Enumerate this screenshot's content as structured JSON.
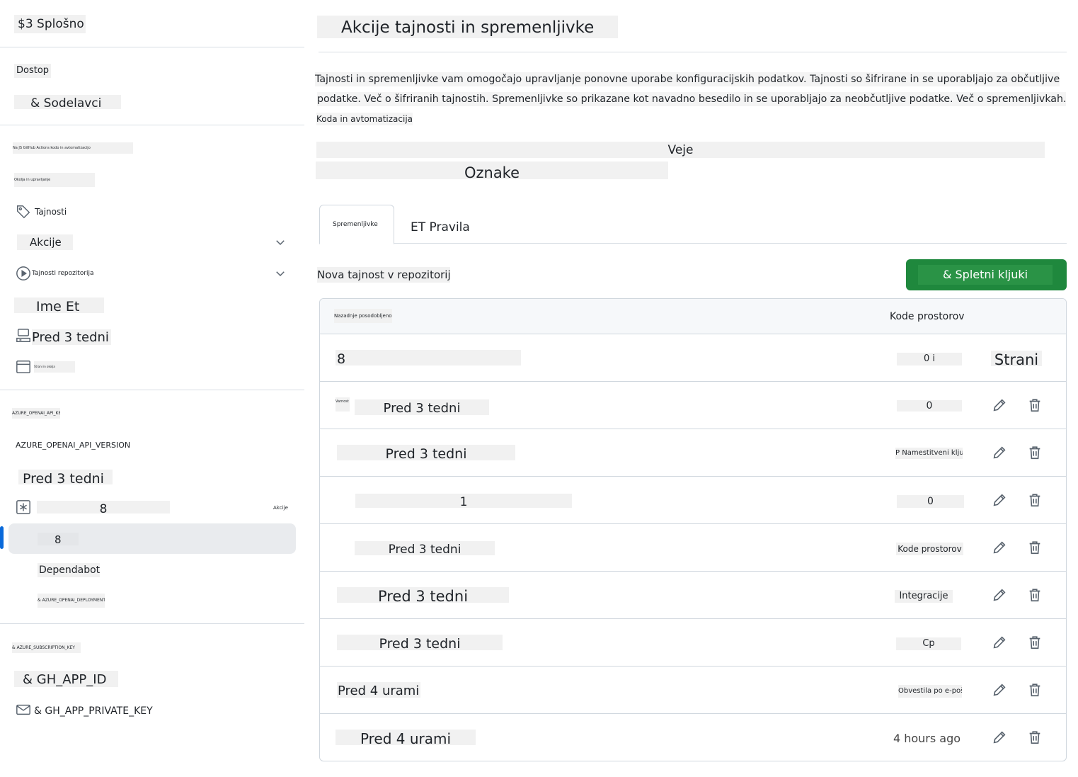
{
  "sidebar": {
    "general": "$3 Splošno",
    "access_heading": "Dostop",
    "collaborators": "& Sodelavci",
    "item_garbled_1": "Na JS GitHub Actions kodo in avtomatizacijo",
    "item_garbled_2": "Okolja in upravljanje",
    "secrets": "Tajnosti",
    "actions": "Akcije",
    "repo_secrets": "Tajnosti repozitorija",
    "name_et": "Ime Et",
    "three_weeks_1": "Pred 3 tedni",
    "pages_small": "Strani in okolja",
    "azure_openai_api_key": "AZURE_OPENAI_API_KEY",
    "azure_openai_api_version": "AZURE_OPENAI_API_VERSION",
    "three_weeks_2": "Pred 3 tedni",
    "eight_1": "8",
    "akcije_small": "Akcije",
    "eight_2": "8",
    "dependabot": "Dependabot",
    "azure_deployment": "& AZURE_OPENAI_DEPLOYMENT",
    "azure_subscription_key": "& AZURE_SUBSCRIPTION_KEY",
    "gh_app_id": "& GH_APP_ID",
    "gh_app_private_key": "& GH_APP_PRIVATE_KEY"
  },
  "main": {
    "title": "Akcije tajnosti in spremenljivke",
    "description_line1": "Tajnosti in spremenljivke vam omogočajo upravljanje ponovne uporabe konfiguracijskih podatkov. Tajnosti so šifrirane in se uporabljajo za občutljive",
    "description_line2": "podatke. Več o šifriranih tajnostih. Spremenljivke so prikazane kot navadno besedilo in se uporabljajo za neobčutljive podatke. Več o spremenljivkah.",
    "description_line3": "Koda in avtomatizacija",
    "branches": "Veje",
    "tags": "Oznake",
    "tabs": [
      {
        "label": "Spremenljivke"
      },
      {
        "label": "ET Pravila"
      }
    ],
    "section_title": "Nova tajnost v repozitoriju",
    "new_button": "& Spletni kljuki",
    "table": {
      "col_updated": "Nazadnje posodobljeno",
      "col_codespaces": "Kode prostorov",
      "rows": [
        {
          "name": "8",
          "value": "0 i",
          "extra": "Strani"
        },
        {
          "name": "Pred 3 tedni",
          "prefix": "Varnost",
          "value": "0",
          "extra": "Urejanje"
        },
        {
          "name": "Pred 3 tedni",
          "value": "P Namestitveni ključi"
        },
        {
          "name": "1",
          "value": "0"
        },
        {
          "name": "Pred 3 tedni",
          "value": "Kode prostorov"
        },
        {
          "name": "Pred 3 tedni",
          "value": "Integracije"
        },
        {
          "name": "Pred 3 tedni",
          "value": "Cp"
        },
        {
          "name": "Pred 4 urami",
          "value": "Obvestila po e-pošti"
        },
        {
          "name": "Pred 4 urami",
          "value": "4 hours ago"
        }
      ]
    }
  },
  "colors": {
    "accent": "#0969da",
    "primary_button": "#1f883d",
    "border": "#d0d7de"
  }
}
